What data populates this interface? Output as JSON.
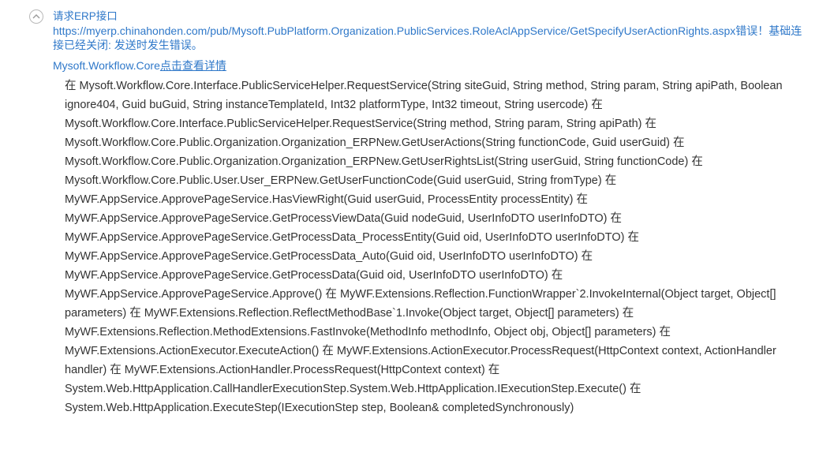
{
  "error": {
    "title": "请求ERP接口",
    "message": "https://myerp.chinahonden.com/pub/Mysoft.PubPlatform.Organization.PublicServices.RoleAclAppService/GetSpecifyUserActionRights.aspx错误！基础连接已经关闭: 发送时发生错误。",
    "source": "Mysoft.Workflow.Core",
    "detail_link": "点击查看详情",
    "stack_trace": "在 Mysoft.Workflow.Core.Interface.PublicServiceHelper.RequestService(String siteGuid, String method, String param, String apiPath, Boolean ignore404, Guid buGuid, String instanceTemplateId, Int32 platformType, Int32 timeout, String usercode) 在 Mysoft.Workflow.Core.Interface.PublicServiceHelper.RequestService(String method, String param, String apiPath) 在 Mysoft.Workflow.Core.Public.Organization.Organization_ERPNew.GetUserActions(String functionCode, Guid userGuid) 在 Mysoft.Workflow.Core.Public.Organization.Organization_ERPNew.GetUserRightsList(String userGuid, String functionCode) 在 Mysoft.Workflow.Core.Public.User.User_ERPNew.GetUserFunctionCode(Guid userGuid, String fromType) 在 MyWF.AppService.ApprovePageService.HasViewRight(Guid userGuid, ProcessEntity processEntity) 在 MyWF.AppService.ApprovePageService.GetProcessViewData(Guid nodeGuid, UserInfoDTO userInfoDTO) 在 MyWF.AppService.ApprovePageService.GetProcessData_ProcessEntity(Guid oid, UserInfoDTO userInfoDTO) 在 MyWF.AppService.ApprovePageService.GetProcessData_Auto(Guid oid, UserInfoDTO userInfoDTO) 在 MyWF.AppService.ApprovePageService.GetProcessData(Guid oid, UserInfoDTO userInfoDTO) 在 MyWF.AppService.ApprovePageService.Approve() 在 MyWF.Extensions.Reflection.FunctionWrapper`2.InvokeInternal(Object target, Object[] parameters) 在 MyWF.Extensions.Reflection.ReflectMethodBase`1.Invoke(Object target, Object[] parameters) 在 MyWF.Extensions.Reflection.MethodExtensions.FastInvoke(MethodInfo methodInfo, Object obj, Object[] parameters) 在 MyWF.Extensions.ActionExecutor.ExecuteAction() 在 MyWF.Extensions.ActionExecutor.ProcessRequest(HttpContext context, ActionHandler handler) 在 MyWF.Extensions.ActionHandler.ProcessRequest(HttpContext context) 在 System.Web.HttpApplication.CallHandlerExecutionStep.System.Web.HttpApplication.IExecutionStep.Execute() 在 System.Web.HttpApplication.ExecuteStep(IExecutionStep step, Boolean& completedSynchronously)"
  },
  "icons": {
    "collapse": "chevron-up-circle-icon"
  },
  "colors": {
    "link": "#2f78c9",
    "text": "#333333",
    "icon_border": "#b9b9b9"
  }
}
